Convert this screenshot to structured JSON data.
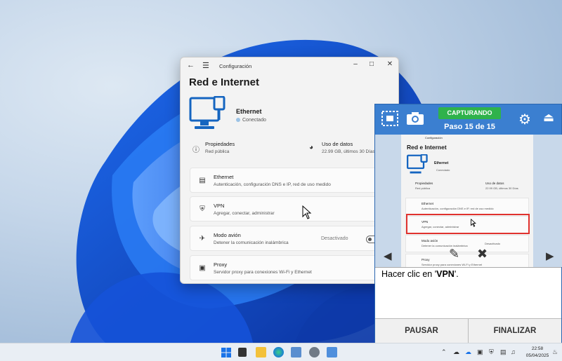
{
  "settings_window": {
    "title": "Configuración",
    "page_title": "Red e Internet",
    "connection": {
      "name": "Ethernet",
      "status": "Conectado"
    },
    "properties": {
      "label": "Propiedades",
      "value": "Red pública"
    },
    "data_usage": {
      "label": "Uso de datos",
      "value": "22.99 GB, últimos 30 Días"
    },
    "items": [
      {
        "label": "Ethernet",
        "sub": "Autenticación, configuración DNS e IP, red de uso medido"
      },
      {
        "label": "VPN",
        "sub": "Agregar, conectar, administrar"
      },
      {
        "label": "Modo avión",
        "sub": "Detener la comunicación inalámbrica",
        "state": "Desactivado"
      },
      {
        "label": "Proxy",
        "sub": "Servidor proxy para conexiones Wi-Fi y Ethernet"
      }
    ]
  },
  "capture_panel": {
    "status_badge": "CAPTURANDO",
    "step": "Paso 15 de 15",
    "description_prefix": "Hacer clic en '",
    "description_target": "VPN",
    "description_suffix": "'.",
    "pause_label": "PAUSAR",
    "finish_label": "FINALIZAR",
    "status_color": "#2fb24b",
    "panel_color": "#3b7fd0",
    "highlight_color": "#e0322e",
    "preview": {
      "title": "Configuración",
      "page_title": "Red e Internet",
      "connection_name": "Ethernet",
      "connection_status": "Conectado",
      "properties_label": "Propiedades",
      "properties_value": "Red pública",
      "data_label": "Uso de datos",
      "data_value": "22.99 GB, últimos 30 Días",
      "items": [
        {
          "label": "Ethernet",
          "sub": "Autenticación, configuración DNS e IP, red de uso medido"
        },
        {
          "label": "VPN",
          "sub": "Agregar, conectar, administrar"
        },
        {
          "label": "Modo avión",
          "sub": "Detener la comunicación inalámbrica",
          "state": "Desactivado"
        },
        {
          "label": "Proxy",
          "sub": "Servidor proxy para conexiones Wi-Fi y Ethernet"
        }
      ]
    }
  },
  "taskbar": {
    "time": "22:58",
    "date": "05/04/2025"
  }
}
